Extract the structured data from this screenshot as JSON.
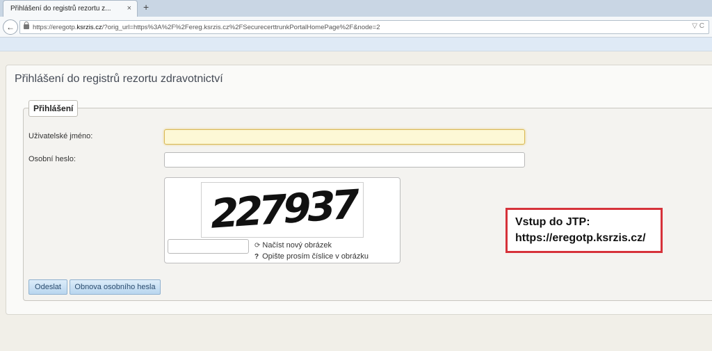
{
  "browser": {
    "tab_title": "Přihlášení do registrů rezortu z...",
    "tab_close": "×",
    "new_tab": "+",
    "back": "←",
    "url_prefix": "https://eregotp.",
    "url_domain": "ksrzis.cz",
    "url_rest": "/?orig_url=https%3A%2F%2Fereg.ksrzis.cz%2FSecurecerttrunkPortalHomePage%2F&node=2",
    "url_right": "▽ C"
  },
  "page": {
    "title": "Přihlášení do registrů rezortu zdravotnictví",
    "legend": "Přihlášení",
    "username_label": "Uživatelské jméno:",
    "username_value": "",
    "password_label": "Osobní heslo:",
    "password_value": "",
    "captcha_text": "227937",
    "captcha_input_value": "",
    "reload_icon": "⟳",
    "reload_label": "Načíst nový obrázek",
    "help_icon": "?",
    "help_label": "Opište prosím číslice v obrázku",
    "submit_label": "Odeslat",
    "reset_password_label": "Obnova osobního hesla"
  },
  "annotation": {
    "line1": "Vstup do JTP:",
    "line2": "https://eregotp.ksrzis.cz/"
  },
  "colors": {
    "annotation_border": "#d6323a",
    "button_text": "#2a4c6e",
    "focused_input": "#fdf8d6"
  }
}
